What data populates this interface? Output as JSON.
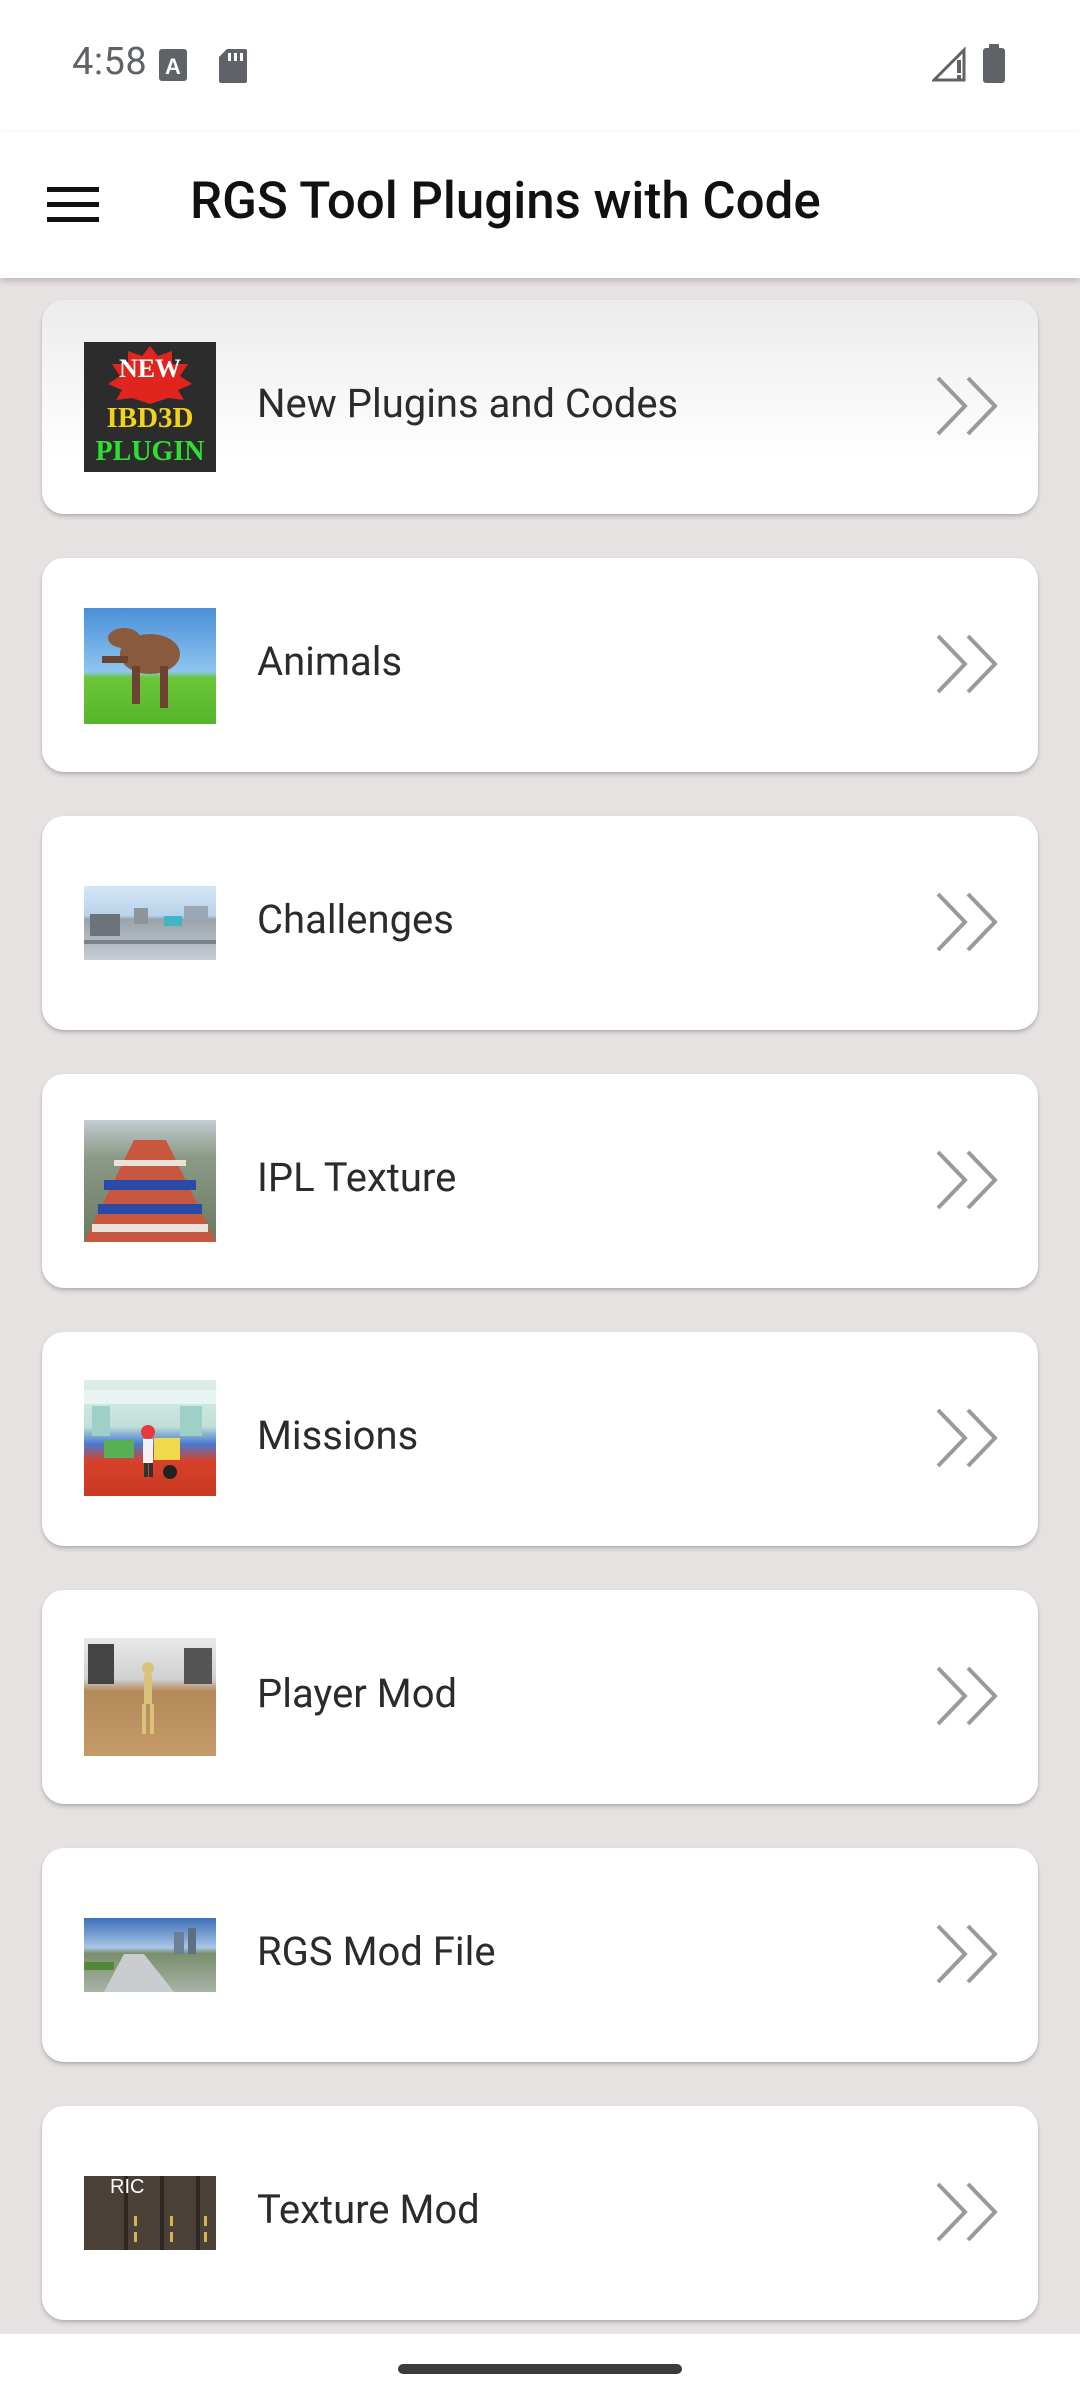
{
  "status_bar": {
    "time": "4:58",
    "icons": [
      "keyboard-a-icon",
      "sd-card-icon",
      "signal-icon",
      "battery-icon"
    ]
  },
  "app_bar": {
    "title": "RGS Tool Plugins with Code",
    "menu_icon": "hamburger-menu-icon"
  },
  "categories": [
    {
      "label": "New Plugins and Codes",
      "thumb": "new-plugins-thumbnail",
      "thumb_text": [
        "NEW",
        "IBD3D",
        "PLUGIN"
      ]
    },
    {
      "label": "Animals",
      "thumb": "animals-thumbnail"
    },
    {
      "label": "Challenges",
      "thumb": "challenges-thumbnail"
    },
    {
      "label": "IPL Texture",
      "thumb": "ipl-texture-thumbnail"
    },
    {
      "label": "Missions",
      "thumb": "missions-thumbnail"
    },
    {
      "label": "Player Mod",
      "thumb": "player-mod-thumbnail"
    },
    {
      "label": "RGS Mod File",
      "thumb": "rgs-mod-file-thumbnail"
    },
    {
      "label": "Texture Mod",
      "thumb": "texture-mod-thumbnail",
      "thumb_text": [
        "RIC"
      ]
    }
  ],
  "colors": {
    "background": "#e7e2e2",
    "card": "#ffffff",
    "chevron": "#9a9a9a"
  }
}
